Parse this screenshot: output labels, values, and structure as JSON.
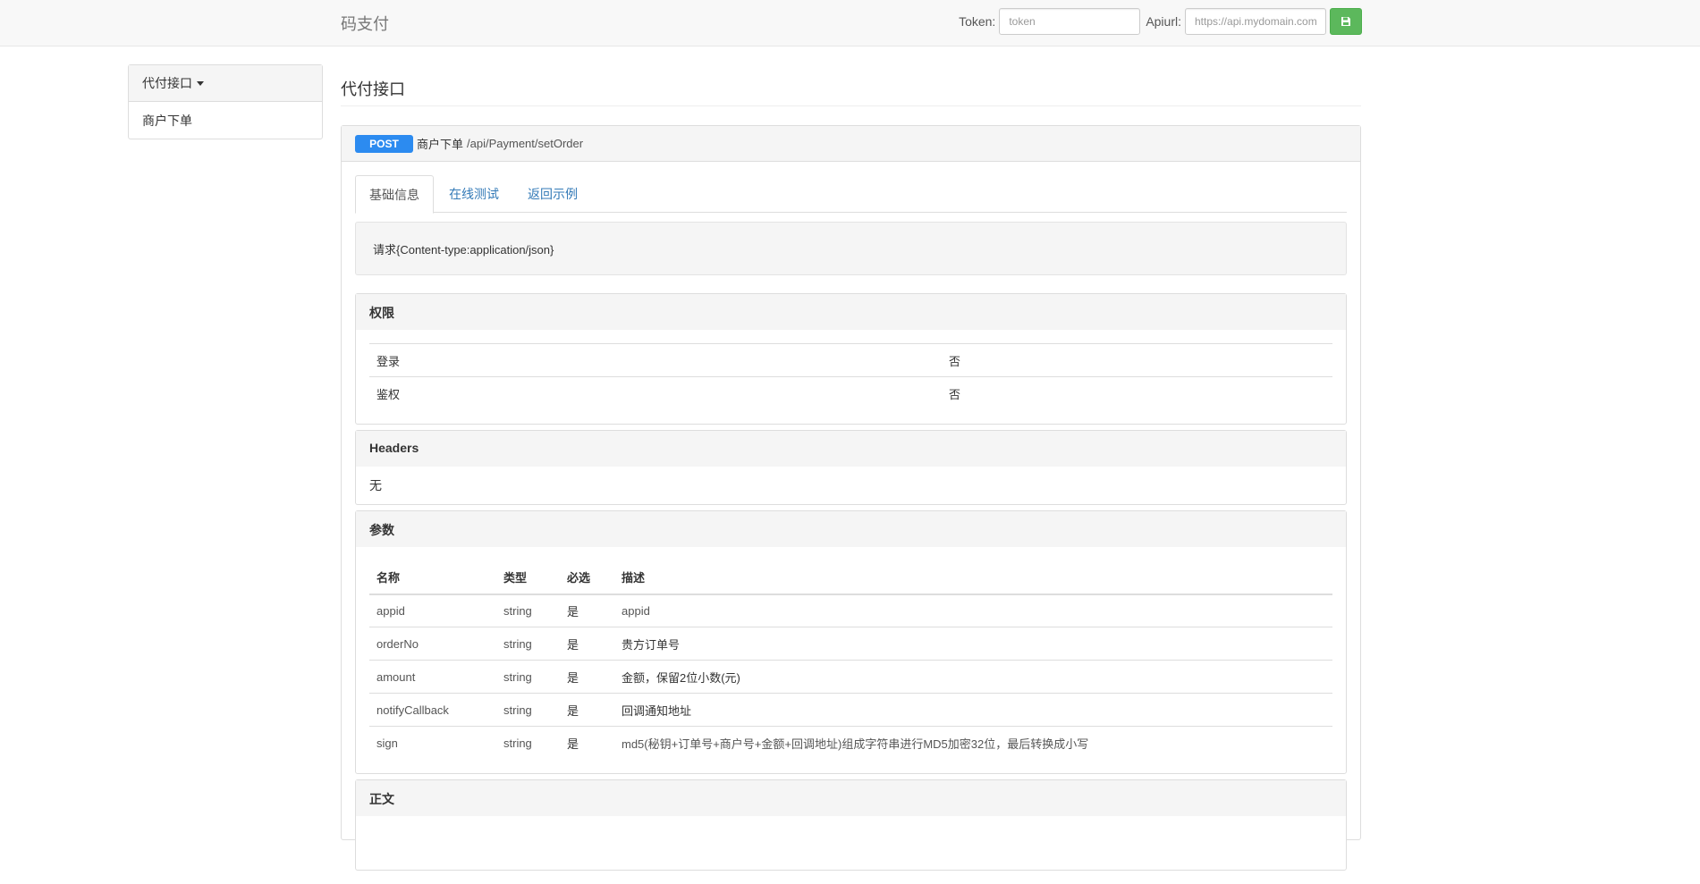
{
  "navbar": {
    "brand": "码支付",
    "token_label": "Token:",
    "token_placeholder": "token",
    "apiurl_label": "Apiurl:",
    "apiurl_placeholder": "https://api.mydomain.com",
    "save_icon": "floppy-disk-icon"
  },
  "sidebar": {
    "group_label": "代付接口",
    "items": [
      {
        "label": "商户下单"
      }
    ]
  },
  "main": {
    "title": "代付接口",
    "api": {
      "method": "POST",
      "name": "商户下单",
      "path": "/api/Payment/setOrder",
      "tabs": [
        {
          "label": "基础信息",
          "active": true
        },
        {
          "label": "在线测试",
          "active": false
        },
        {
          "label": "返回示例",
          "active": false
        }
      ],
      "request_note": "请求{Content-type:application/json}",
      "permissions": {
        "title": "权限",
        "rows": [
          {
            "name": "登录",
            "value": "否"
          },
          {
            "name": "鉴权",
            "value": "否"
          }
        ]
      },
      "headers": {
        "title": "Headers",
        "content": "无"
      },
      "params": {
        "title": "参数",
        "columns": [
          "名称",
          "类型",
          "必选",
          "描述"
        ],
        "rows": [
          {
            "name": "appid",
            "type": "string",
            "required": "是",
            "desc": "appid"
          },
          {
            "name": "orderNo",
            "type": "string",
            "required": "是",
            "desc": "贵方订单号"
          },
          {
            "name": "amount",
            "type": "string",
            "required": "是",
            "desc": "金额，保留2位小数(元)"
          },
          {
            "name": "notifyCallback",
            "type": "string",
            "required": "是",
            "desc": "回调通知地址"
          },
          {
            "name": "sign",
            "type": "string",
            "required": "是",
            "desc": "md5(秘钥+订单号+商户号+金额+回调地址)组成字符串进行MD5加密32位，最后转换成小写"
          }
        ]
      },
      "body": {
        "title": "正文"
      }
    }
  },
  "colors": {
    "method_badge": "#2c8bf0",
    "save_button": "#5cb85c",
    "link": "#337ab7"
  }
}
